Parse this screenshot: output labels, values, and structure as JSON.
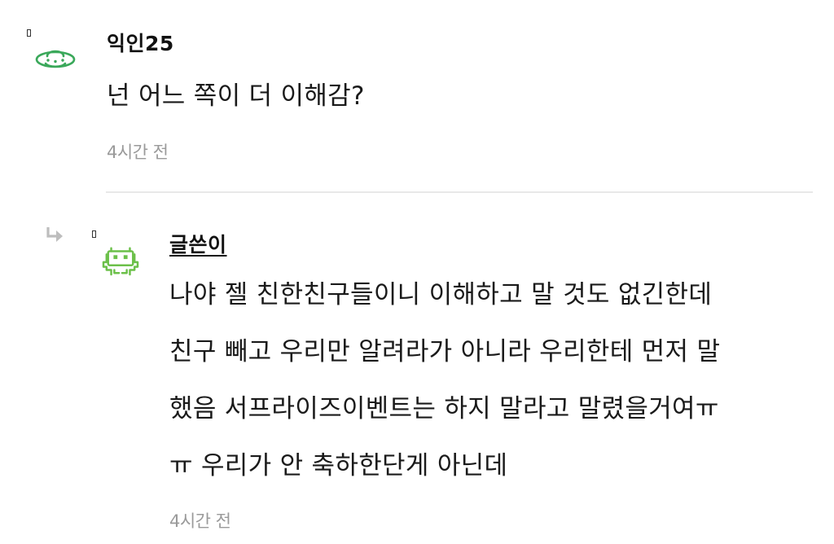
{
  "comments": [
    {
      "author": "익인25",
      "body_lines": [
        "넌 어느 쪽이 더 이해감?"
      ],
      "time": "4시간 전",
      "avatar_icon": "ufo-icon",
      "avatar_color": "#3aa85a"
    },
    {
      "author": "글쓴이",
      "body_lines": [
        "나야 젤 친한친구들이니 이해하고 말 것도 없긴한데",
        "친구 빼고 우리만 알려라가 아니라 우리한테 먼저 말",
        "했음 서프라이즈이벤트는 하지 말라고 말렸을거여ㅠ",
        "ㅠ 우리가 안 축하한단게 아닌데"
      ],
      "time": "4시간 전",
      "avatar_icon": "space-invader-icon",
      "avatar_color": "#6cc04a",
      "reply_icon": "reply-arrow-icon"
    }
  ],
  "colors": {
    "text": "#1a1a1a",
    "muted": "#9a9a9a",
    "divider": "#e8e8e8"
  }
}
